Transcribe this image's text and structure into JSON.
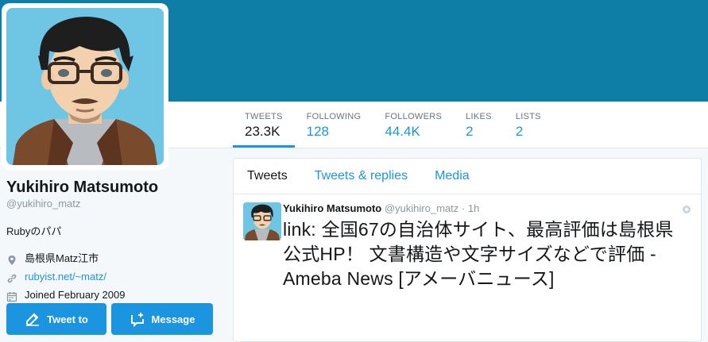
{
  "profile": {
    "name": "Yukihiro Matsumoto",
    "handle": "@yukihiro_matz",
    "bio": "Rubyのパパ",
    "location": "島根県Matz江市",
    "website": "rubyist.net/~matz/",
    "joined": "Joined February 2009"
  },
  "stats": [
    {
      "label": "TWEETS",
      "value": "23.3K"
    },
    {
      "label": "FOLLOWING",
      "value": "128"
    },
    {
      "label": "FOLLOWERS",
      "value": "44.4K"
    },
    {
      "label": "LIKES",
      "value": "2"
    },
    {
      "label": "LISTS",
      "value": "2"
    }
  ],
  "buttons": {
    "tweet_to": "Tweet to",
    "message": "Message"
  },
  "tabs": [
    "Tweets",
    "Tweets & replies",
    "Media"
  ],
  "tweet": {
    "name": "Yukihiro Matsumoto",
    "handle": "@yukihiro_matz",
    "sep": "·",
    "time": "1h",
    "text": "link: 全国67の自治体サイト、最高評価は島根県公式HP！ 文書構造や文字サイズなどで評価 - Ameba News [アメーバニュース]"
  },
  "colors": {
    "banner": "#0e7ea6",
    "accent": "#1b95e0",
    "avatar_bg": "#6fc6e4"
  },
  "icons": [
    "location-pin-icon",
    "link-icon",
    "calendar-icon",
    "compose-icon",
    "new-message-icon",
    "tweet-options-icon"
  ]
}
